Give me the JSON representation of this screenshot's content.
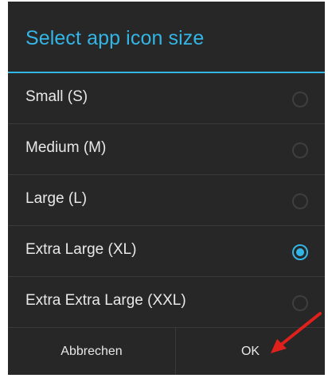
{
  "dialog": {
    "title": "Select app icon size",
    "options": [
      {
        "label": "Small (S)",
        "selected": false
      },
      {
        "label": "Medium (M)",
        "selected": false
      },
      {
        "label": "Large (L)",
        "selected": false
      },
      {
        "label": "Extra Large (XL)",
        "selected": true
      },
      {
        "label": "Extra Extra Large (XXL)",
        "selected": false
      }
    ],
    "buttons": {
      "cancel_label": "Abbrechen",
      "ok_label": "OK"
    }
  },
  "colors": {
    "accent": "#33b5e5",
    "background": "#272727",
    "annotation_arrow": "#e0201b"
  }
}
